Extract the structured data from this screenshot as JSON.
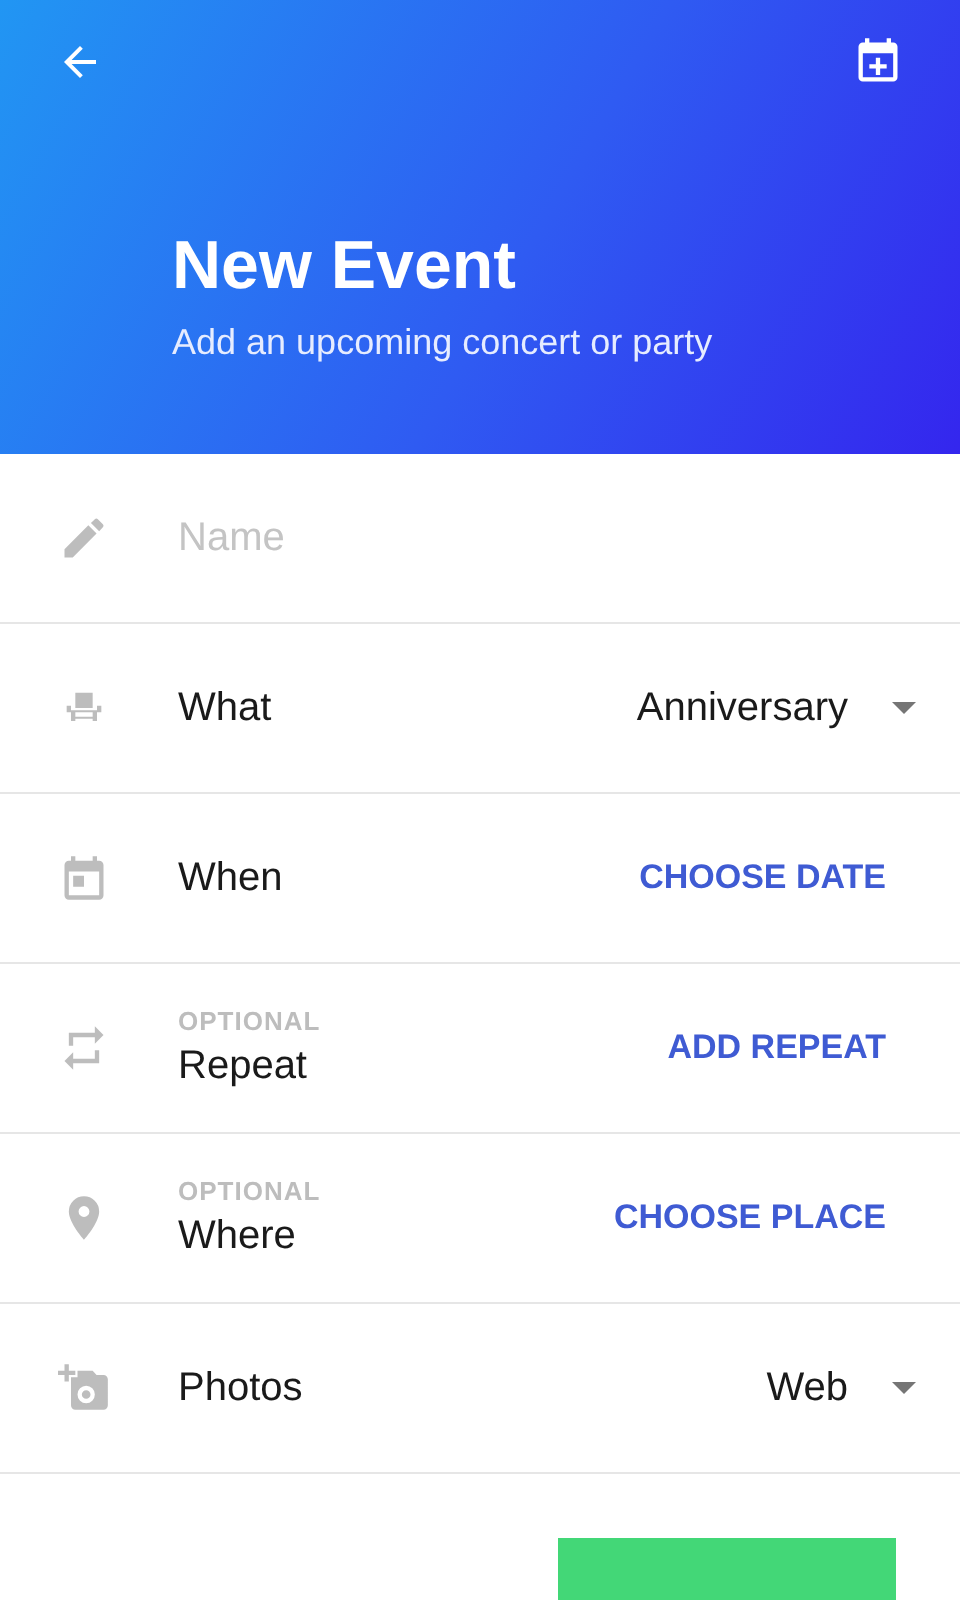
{
  "header": {
    "title": "New Event",
    "subtitle": "Add an upcoming concert or party"
  },
  "rows": [
    {
      "kind": "input",
      "placeholder": "Name"
    },
    {
      "kind": "select",
      "label": "What",
      "value": "Anniversary"
    },
    {
      "kind": "action",
      "label": "When",
      "action": "CHOOSE DATE"
    },
    {
      "kind": "action",
      "hint": "OPTIONAL",
      "label": "Repeat",
      "action": "ADD REPEAT"
    },
    {
      "kind": "action",
      "hint": "OPTIONAL",
      "label": "Where",
      "action": "CHOOSE PLACE"
    },
    {
      "kind": "select",
      "label": "Photos",
      "value": "Web"
    }
  ]
}
